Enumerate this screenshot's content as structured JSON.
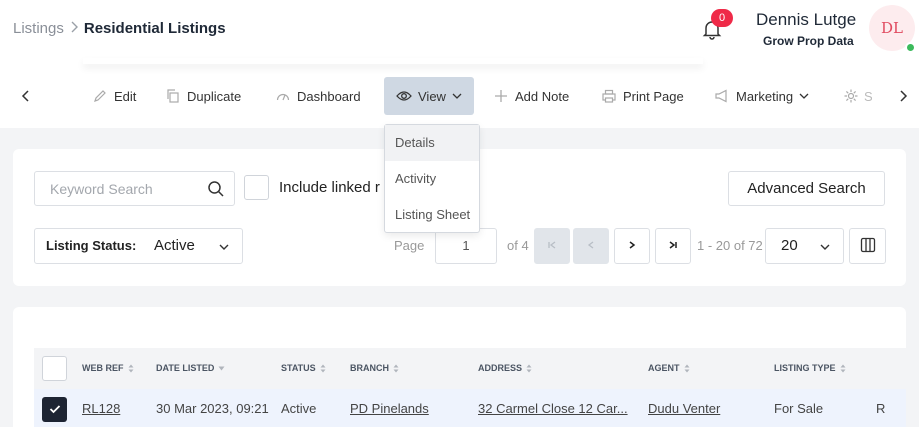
{
  "breadcrumb": {
    "root": "Listings",
    "current": "Residential Listings"
  },
  "notifications": {
    "count": "0"
  },
  "user": {
    "name": "Dennis Lutge",
    "org": "Grow Prop Data",
    "initials": "DL"
  },
  "toolbar": {
    "edit": "Edit",
    "duplicate": "Duplicate",
    "dashboard": "Dashboard",
    "view": "View",
    "add_note": "Add Note",
    "print_page": "Print Page",
    "marketing": "Marketing",
    "clipped": "S"
  },
  "view_menu": {
    "items": [
      "Details",
      "Activity",
      "Listing Sheet"
    ]
  },
  "filters": {
    "keyword_placeholder": "Keyword Search",
    "include_linked": "Include linked r",
    "advanced_search": "Advanced Search",
    "status_label": "Listing Status:",
    "status_value": "Active"
  },
  "pagination": {
    "page_label": "Page",
    "page_value": "1",
    "of_label": "of 4",
    "range": "1 - 20 of 72",
    "per_page": "20"
  },
  "table": {
    "columns": [
      "WEB REF",
      "DATE LISTED",
      "STATUS",
      "BRANCH",
      "ADDRESS",
      "AGENT",
      "LISTING TYPE"
    ],
    "rows": [
      {
        "web_ref": "RL128",
        "date_listed": "30 Mar 2023, 09:21",
        "status": "Active",
        "branch": "PD Pinelands",
        "address": "32 Carmel Close 12 Car...",
        "agent": "Dudu Venter",
        "listing_type": "For Sale",
        "extra": "R"
      }
    ]
  },
  "colors": {
    "badge": "#ef2a48",
    "online": "#3cba5c",
    "active_tab": "#cfd8e3",
    "selected_row": "#eef3fd"
  }
}
